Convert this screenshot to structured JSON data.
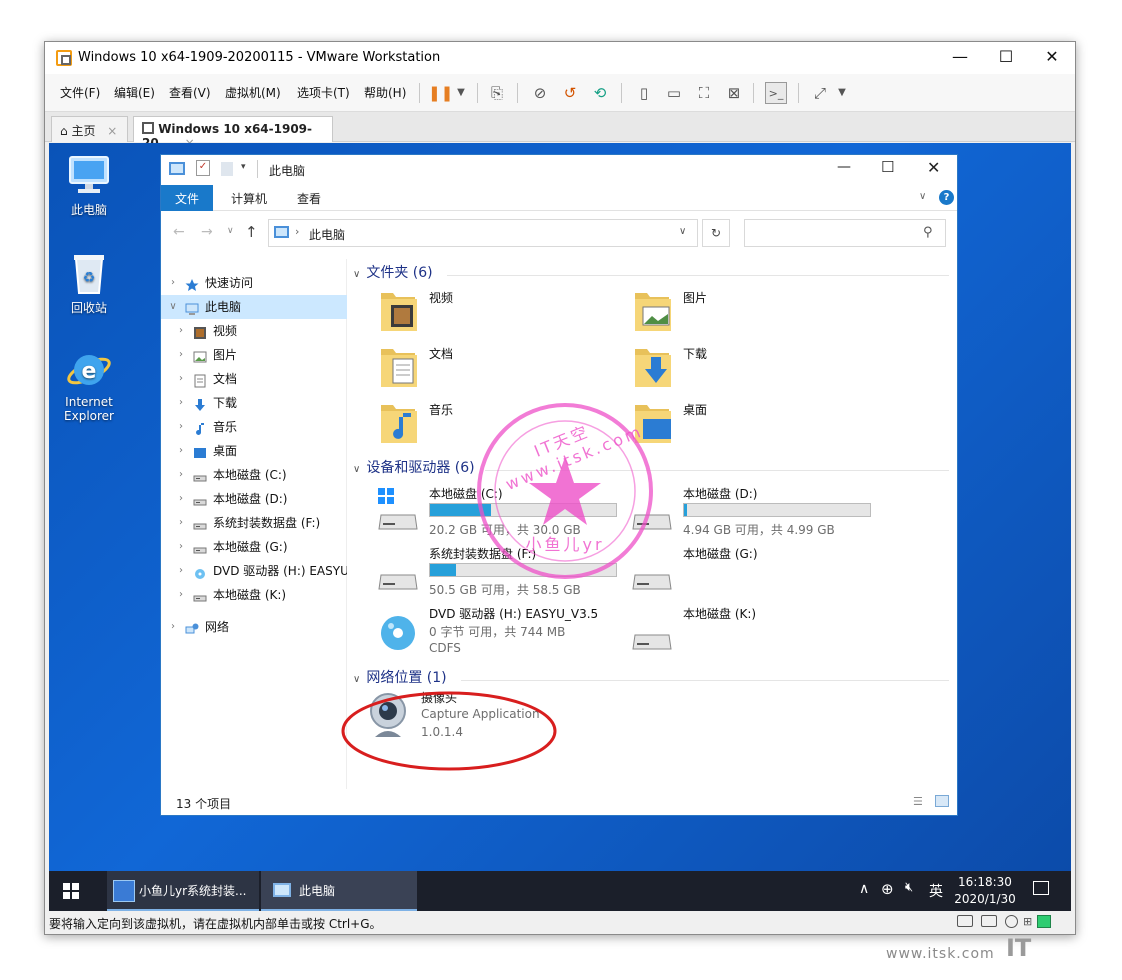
{
  "vmware": {
    "title": "Windows 10 x64-1909-20200115 - VMware Workstation",
    "menu": [
      "文件(F)",
      "编辑(E)",
      "查看(V)",
      "虚拟机(M)",
      "选项卡(T)",
      "帮助(H)"
    ],
    "tabs": [
      {
        "label": "主页",
        "close": "×"
      },
      {
        "label": "Windows 10 x64-1909-20...",
        "close": "×"
      }
    ],
    "status_message": "要将输入定向到该虚拟机，请在虚拟机内部单击或按 Ctrl+G。",
    "window_buttons": {
      "minimize": "—",
      "maximize": "☐",
      "close": "✕"
    }
  },
  "desktop": {
    "icons": [
      {
        "label": "此电脑",
        "icon": "computer-icon"
      },
      {
        "label": "回收站",
        "icon": "recycle-bin-icon"
      },
      {
        "label": "Internet Explorer",
        "icon": "ie-icon"
      }
    ]
  },
  "explorer": {
    "title": "此电脑",
    "ribbon_tabs": [
      "文件",
      "计算机",
      "查看"
    ],
    "address": "此电脑",
    "search_placeholder": "",
    "nav": [
      {
        "label": "快速访问",
        "level": 0,
        "icon": "star-icon",
        "expanded": false
      },
      {
        "label": "此电脑",
        "level": 0,
        "icon": "computer-icon",
        "expanded": true,
        "selected": true
      },
      {
        "label": "视频",
        "level": 1,
        "icon": "video-icon"
      },
      {
        "label": "图片",
        "level": 1,
        "icon": "picture-icon"
      },
      {
        "label": "文档",
        "level": 1,
        "icon": "document-icon"
      },
      {
        "label": "下载",
        "level": 1,
        "icon": "download-icon"
      },
      {
        "label": "音乐",
        "level": 1,
        "icon": "music-icon"
      },
      {
        "label": "桌面",
        "level": 1,
        "icon": "desktop-icon"
      },
      {
        "label": "本地磁盘 (C:)",
        "level": 1,
        "icon": "drive-icon"
      },
      {
        "label": "本地磁盘 (D:)",
        "level": 1,
        "icon": "drive-icon"
      },
      {
        "label": "系统封装数据盘 (F:)",
        "level": 1,
        "icon": "drive-icon"
      },
      {
        "label": "本地磁盘 (G:)",
        "level": 1,
        "icon": "drive-icon"
      },
      {
        "label": "DVD 驱动器 (H:) EASYU",
        "level": 1,
        "icon": "dvd-icon"
      },
      {
        "label": "本地磁盘 (K:)",
        "level": 1,
        "icon": "drive-icon"
      },
      {
        "label": "网络",
        "level": 0,
        "icon": "network-icon",
        "expanded": false
      }
    ],
    "groups": {
      "folders": {
        "header": "文件夹 (6)",
        "items": [
          "视频",
          "图片",
          "文档",
          "下载",
          "音乐",
          "桌面"
        ]
      },
      "devices": {
        "header": "设备和驱动器 (6)",
        "items": [
          {
            "name": "本地磁盘 (C:)",
            "info": "20.2 GB 可用，共 30.0 GB",
            "used_fraction": 0.33,
            "bar": true
          },
          {
            "name": "本地磁盘 (D:)",
            "info": "4.94 GB 可用，共 4.99 GB",
            "used_fraction": 0.01,
            "bar": true
          },
          {
            "name": "系统封装数据盘 (F:)",
            "info": "50.5 GB 可用，共 58.5 GB",
            "used_fraction": 0.14,
            "bar": true
          },
          {
            "name": "本地磁盘 (G:)",
            "info": "",
            "bar": false
          },
          {
            "name": "DVD 驱动器 (H:) EASYU_V3.5",
            "info": "0 字节 可用，共 744 MB",
            "info2": "CDFS",
            "bar": false
          },
          {
            "name": "本地磁盘 (K:)",
            "info": "",
            "bar": false
          }
        ]
      },
      "network": {
        "header": "网络位置 (1)",
        "item": {
          "name": "摄像头",
          "line2": "Capture Application",
          "line3": "1.0.1.4"
        }
      }
    },
    "status": "13 个项目"
  },
  "taskbar": {
    "apps": [
      {
        "label": "小鱼儿yr系统封装..."
      },
      {
        "label": "此电脑"
      }
    ],
    "ime": "英",
    "time": "16:18:30",
    "date": "2020/1/30"
  },
  "watermark": {
    "text": "IT天空www.itsk.com",
    "inner": "小鱼儿yr",
    "footer": "www.itsk.com"
  },
  "colors": {
    "accent": "#1979ca",
    "desktop": "#0a53b8",
    "stamp": "#ee50c8",
    "annotation": "#d81e1e"
  }
}
